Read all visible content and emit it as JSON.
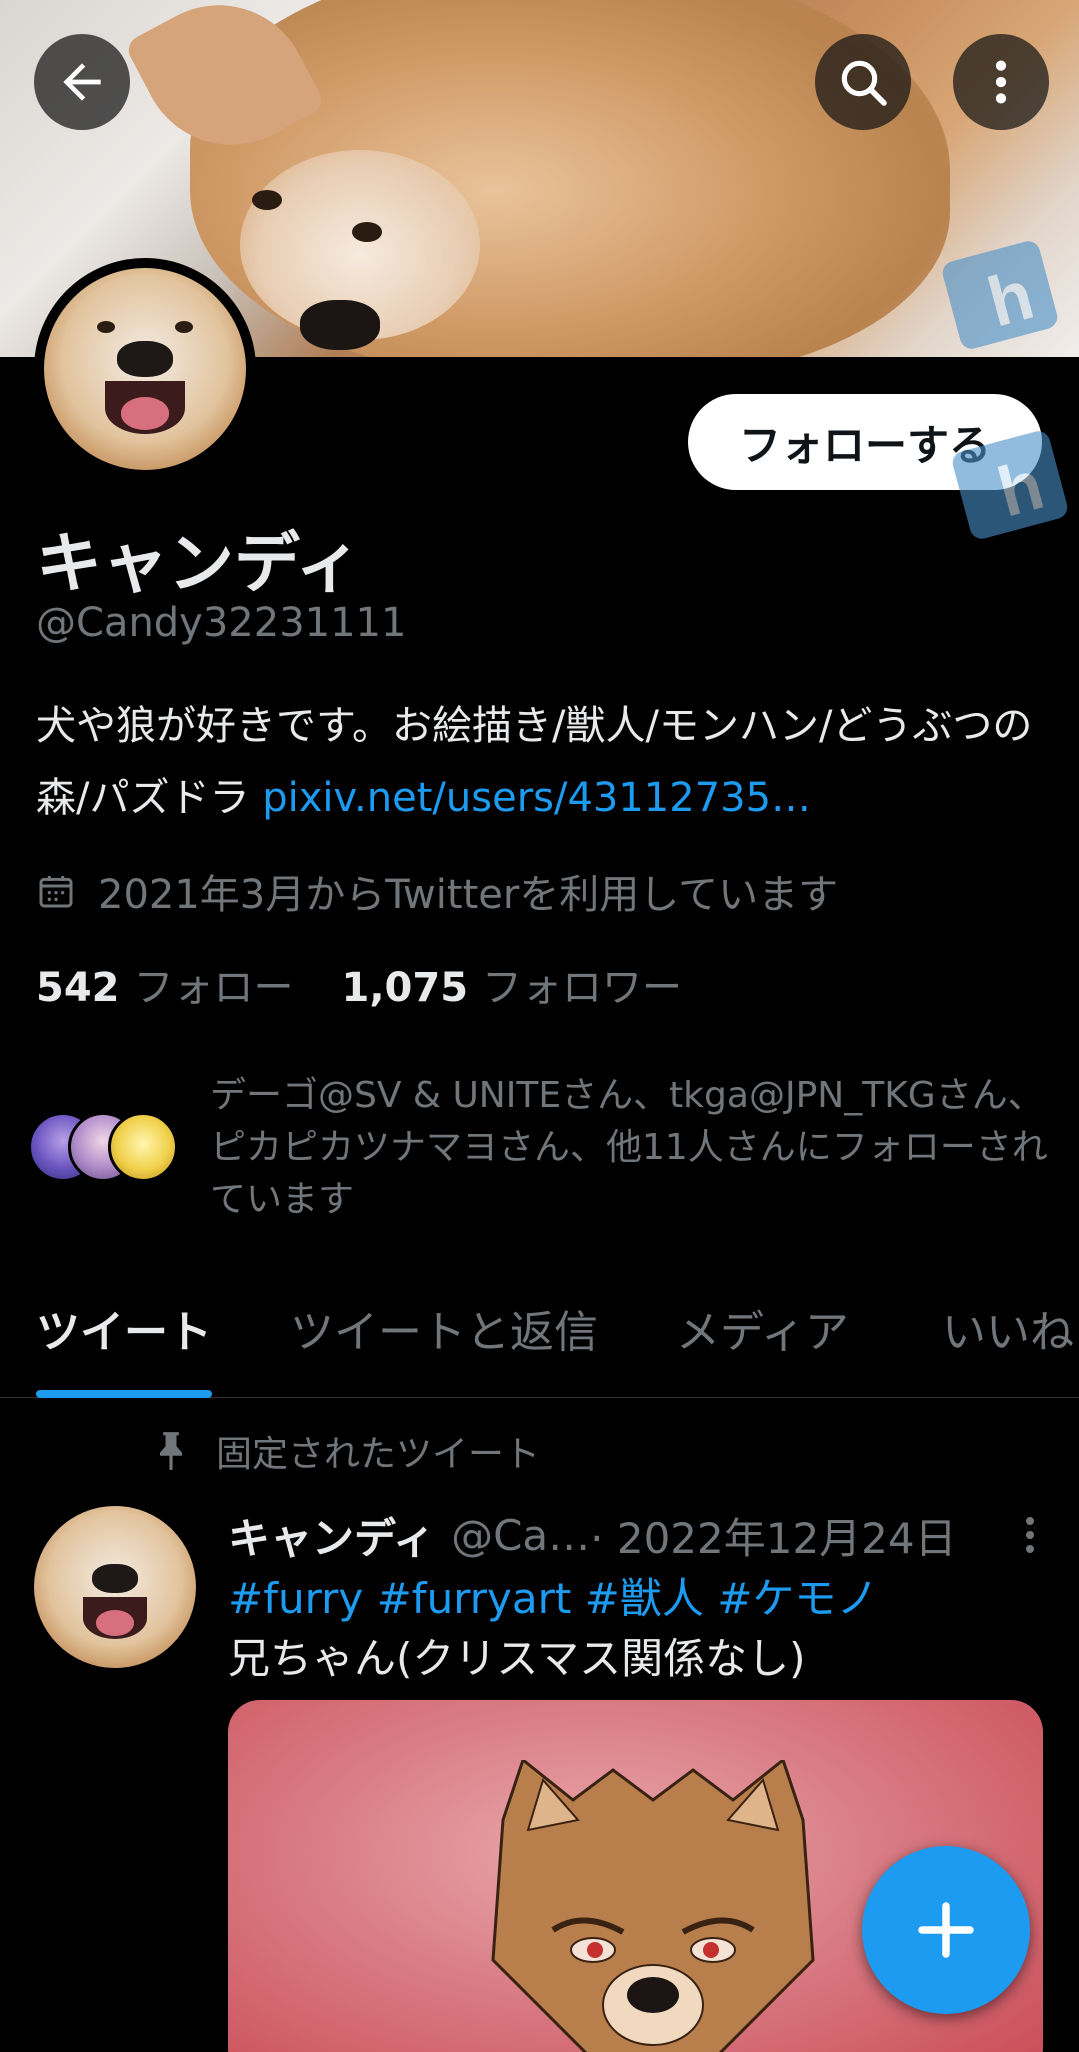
{
  "header": {
    "back_icon": "arrow-left-icon",
    "search_icon": "search-icon",
    "more_icon": "more-vertical-icon"
  },
  "profile": {
    "follow_label": "フォローする",
    "display_name": "キャンディ",
    "handle": "@Candy32231111",
    "bio_text": "犬や狼が好きです。お絵描き/獣人/モンハン/どうぶつの森/パズドラ ",
    "bio_link": "pixiv.net/users/43112735…",
    "joined": "2021年3月からTwitterを利用しています",
    "following_count": "542",
    "following_label": "フォロー",
    "followers_count": "1,075",
    "followers_label": "フォロワー",
    "followed_by": "デーゴ@SV & UNITEさん、tkga@JPN_TKGさん、ピカピカツナマヨさん、他11人さんにフォローされています"
  },
  "tabs": [
    {
      "label": "ツイート",
      "active": true
    },
    {
      "label": "ツイートと返信",
      "active": false
    },
    {
      "label": "メディア",
      "active": false
    },
    {
      "label": "いいね",
      "active": false
    }
  ],
  "pinned_tweet": {
    "pinned_label": "固定されたツイート",
    "name": "キャンディ",
    "handle": "@Ca…",
    "date": " · 2022年12月24日",
    "hashtags": "#furry #furryart #獣人 #ケモノ",
    "text": "兄ちゃん(クリスマス関係なし)"
  },
  "colors": {
    "accent": "#1d9bf0",
    "background": "#000000",
    "secondary_text": "#71767b"
  }
}
